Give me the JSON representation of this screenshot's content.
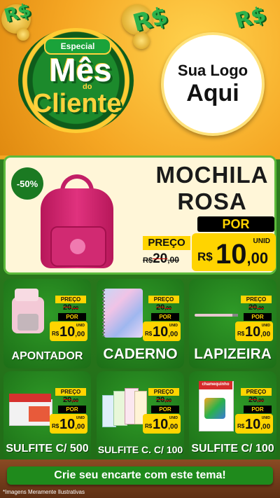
{
  "header": {
    "badge_top": "Especial",
    "badge_line1": "Mês",
    "badge_do": "do",
    "badge_line2": "Cliente",
    "money_symbol": "R$",
    "logo_line1": "Sua Logo",
    "logo_line2": "Aqui"
  },
  "featured": {
    "discount": "-50%",
    "title_line1": "MOCHILA",
    "title_line2": "ROSA",
    "preco_label": "PREÇO",
    "old_currency": "R$",
    "old_int": "20",
    "old_dec": ",00",
    "por_label": "POR",
    "unid_label": "UNID",
    "currency": "R$",
    "price_int": "10",
    "price_dec": ",00"
  },
  "products": [
    {
      "name": "APONTADOR",
      "icon": "sharpener-icon"
    },
    {
      "name": "CADERNO",
      "icon": "notebook-icon"
    },
    {
      "name": "LAPIZEIRA",
      "icon": "pencil-icon"
    },
    {
      "name": "SULFITE C/ 500",
      "icon": "paper-box-icon"
    },
    {
      "name": "SULFITE C. C/ 100",
      "icon": "colored-paper-icon"
    },
    {
      "name": "SULFITE C/ 100",
      "icon": "paper-pack-icon"
    }
  ],
  "tag": {
    "preco_label": "PREÇO",
    "old_int": "20",
    "old_dec": ",00",
    "por_label": "POR",
    "unid_label": "UNID",
    "currency": "R$",
    "price_int": "10",
    "price_dec": ",00"
  },
  "product5_brand": "chamequinho",
  "footer": {
    "cta": "Crie seu encarte com este tema!",
    "disclaimer": "*Imagens Meramente Ilustrativas"
  },
  "colors": {
    "orange_bg": "#f5a623",
    "green_bg": "#1f6b17",
    "yellow_tag": "#ffd400",
    "cream_card": "#fff6d8"
  }
}
